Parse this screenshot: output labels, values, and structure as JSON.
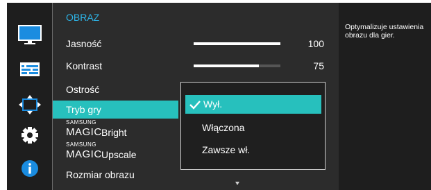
{
  "menu": {
    "title": "OBRAZ",
    "items": [
      {
        "label": "Jasność",
        "value": "100",
        "level": 1.0
      },
      {
        "label": "Kontrast",
        "value": "75",
        "level": 0.75
      },
      {
        "label": "Ostrość"
      },
      {
        "label": "Tryb gry"
      },
      {
        "brand_small": "SAMSUNG",
        "brand_big": "MAGIC",
        "label": "Bright"
      },
      {
        "brand_small": "SAMSUNG",
        "brand_big": "MAGIC",
        "label": "Upscale"
      },
      {
        "label": "Rozmiar obrazu"
      }
    ]
  },
  "submenu": {
    "options": [
      "Wył.",
      "Włączona",
      "Zawsze wł."
    ],
    "selected_index": 0
  },
  "help": {
    "text": "Optymalizuje ustawienia obrazu dla gier."
  },
  "sidebar_icons": [
    "picture-icon",
    "onscreen-display-icon",
    "position-icon",
    "settings-gear-icon",
    "information-icon"
  ],
  "colors": {
    "accent": "#27c0bd",
    "title": "#2db5e8",
    "icon_blue": "#1a8ce0"
  }
}
